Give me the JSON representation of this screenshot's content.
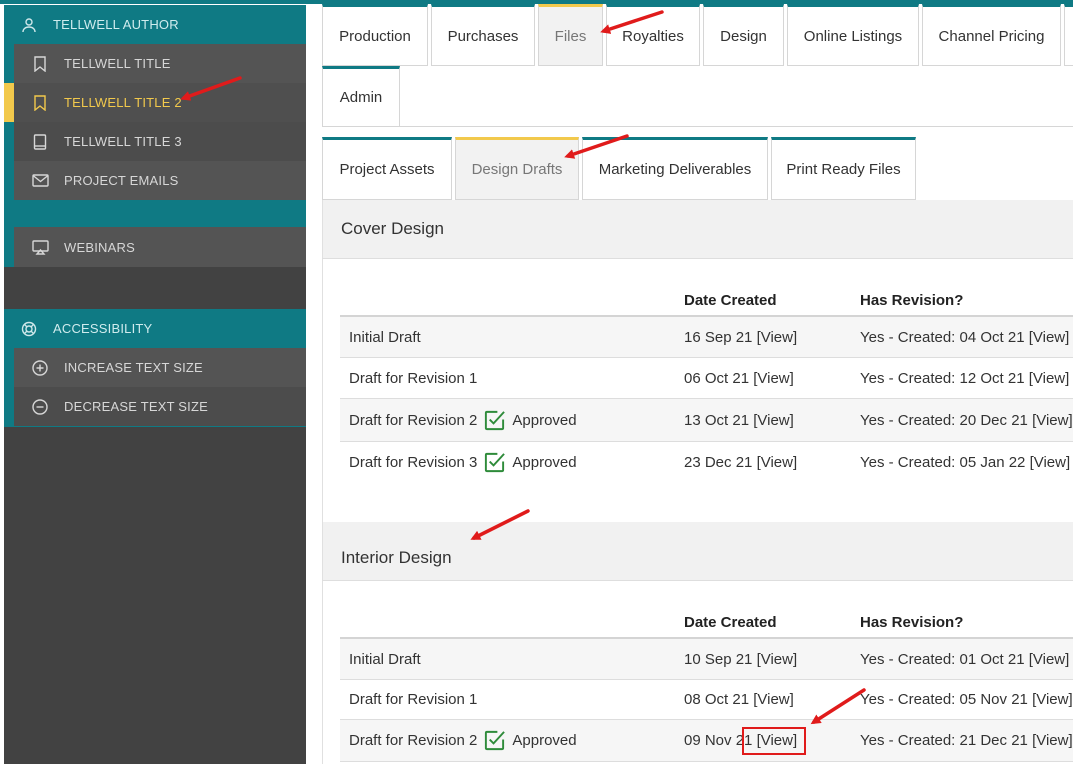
{
  "sidebar": {
    "author": {
      "label": "TELLWELL AUTHOR",
      "icon": "user-icon"
    },
    "titles": [
      {
        "label": "TELLWELL TITLE",
        "icon": "bookmark-icon"
      },
      {
        "label": "TELLWELL TITLE 2",
        "icon": "bookmark-icon",
        "active": true
      },
      {
        "label": "TELLWELL TITLE 3",
        "icon": "book-icon"
      },
      {
        "label": "PROJECT EMAILS",
        "icon": "envelope-icon"
      }
    ],
    "webinars": {
      "label": "WEBINARS",
      "icon": "screen-icon"
    },
    "accessibility": {
      "label": "ACCESSIBILITY",
      "icon": "lifebuoy-icon"
    },
    "text_size": [
      {
        "label": "INCREASE TEXT SIZE",
        "icon": "plus-circle-icon"
      },
      {
        "label": "DECREASE TEXT SIZE",
        "icon": "minus-circle-icon"
      }
    ]
  },
  "main_tabs": [
    "Production",
    "Purchases",
    "Files",
    "Royalties",
    "Design",
    "Online Listings",
    "Channel Pricing",
    "Admin"
  ],
  "main_tab_active": "Files",
  "sub_tabs": [
    "Project Assets",
    "Design Drafts",
    "Marketing Deliverables",
    "Print Ready Files"
  ],
  "sub_tab_active": "Design Drafts",
  "columns": {
    "date": "Date Created",
    "revision": "Has Revision?"
  },
  "cover_design": {
    "title": "Cover Design",
    "rows": [
      {
        "name": "Initial Draft",
        "approved": false,
        "date": "16 Sep 21",
        "view": "[View]",
        "revision": "Yes - Created: 04 Oct 21",
        "rev_view": "[View]"
      },
      {
        "name": "Draft for Revision 1",
        "approved": false,
        "date": "06 Oct 21",
        "view": "[View]",
        "revision": "Yes - Created: 12 Oct 21",
        "rev_view": "[View]"
      },
      {
        "name": "Draft for Revision 2",
        "approved": true,
        "date": "13 Oct 21",
        "view": "[View]",
        "revision": "Yes - Created: 20 Dec 21",
        "rev_view": "[View]"
      },
      {
        "name": "Draft for Revision 3",
        "approved": true,
        "date": "23 Dec 21",
        "view": "[View]",
        "revision": "Yes - Created: 05 Jan 22",
        "rev_view": "[View]"
      }
    ]
  },
  "interior_design": {
    "title": "Interior Design",
    "rows": [
      {
        "name": "Initial Draft",
        "approved": false,
        "date": "10 Sep 21",
        "view": "[View]",
        "revision": "Yes - Created: 01 Oct 21",
        "rev_view": "[View]"
      },
      {
        "name": "Draft for Revision 1",
        "approved": false,
        "date": "08 Oct 21",
        "view": "[View]",
        "revision": "Yes - Created: 05 Nov 21",
        "rev_view": "[View]"
      },
      {
        "name": "Draft for Revision 2",
        "approved": true,
        "date": "09 Nov 21",
        "view": "[View]",
        "revision": "Yes - Created: 21 Dec 21",
        "rev_view": "[View]"
      }
    ]
  },
  "approved_label": "Approved",
  "colors": {
    "teal": "#0f7a84",
    "active_yellow": "#f2c94c",
    "approved_green": "#2e8b3a",
    "annotation_red": "#e01b1b"
  }
}
